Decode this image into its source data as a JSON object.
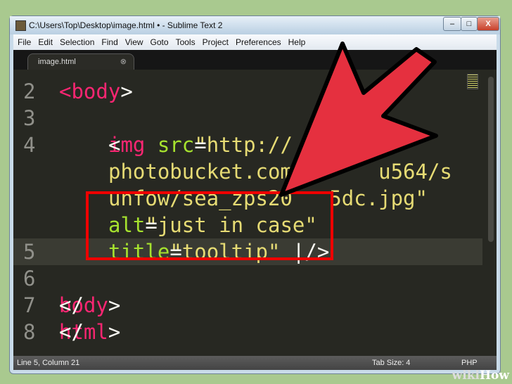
{
  "window": {
    "title": "C:\\Users\\Top\\Desktop\\image.html • - Sublime Text 2",
    "minimize": "–",
    "maximize": "□",
    "close": "X"
  },
  "menu": [
    "File",
    "Edit",
    "Selection",
    "Find",
    "View",
    "Goto",
    "Tools",
    "Project",
    "Preferences",
    "Help"
  ],
  "tab": {
    "label": "image.html",
    "close": "⊗"
  },
  "code": [
    {
      "num": "2",
      "parts": [
        [
          "tag",
          "<"
        ],
        [
          "tag",
          "body"
        ],
        [
          "tx",
          ">"
        ]
      ]
    },
    {
      "num": "3",
      "parts": []
    },
    {
      "num": "4",
      "parts": [
        [
          "tx",
          "<"
        ],
        [
          "tag",
          "img "
        ],
        [
          "attr",
          "src"
        ],
        [
          "tx",
          "="
        ],
        [
          "str",
          "\"http://"
        ]
      ]
    },
    {
      "num": "",
      "parts": [
        [
          "str",
          "photobucket.com/"
        ],
        [
          "str",
          "      "
        ],
        [
          "str",
          "u564/s"
        ]
      ]
    },
    {
      "num": "",
      "parts": [
        [
          "str",
          "unfow/sea_zps20"
        ],
        [
          "str",
          "   "
        ],
        [
          "str",
          "5dc.jpg\""
        ]
      ]
    },
    {
      "num": "",
      "parts": [
        [
          "attr",
          "alt"
        ],
        [
          "tx",
          "="
        ],
        [
          "str",
          "\"just in case\""
        ]
      ]
    },
    {
      "num": "5",
      "parts": [
        [
          "attr",
          "title"
        ],
        [
          "tx",
          "="
        ],
        [
          "str",
          "\"tooltip\""
        ],
        [
          "tx",
          " |/>"
        ]
      ]
    },
    {
      "num": "6",
      "parts": []
    },
    {
      "num": "7",
      "parts": [
        [
          "tx",
          "</"
        ],
        [
          "tag",
          "body"
        ],
        [
          "tx",
          ">"
        ]
      ]
    },
    {
      "num": "8",
      "parts": [
        [
          "tx",
          "</"
        ],
        [
          "tag",
          "html"
        ],
        [
          "tx",
          ">"
        ]
      ]
    }
  ],
  "status": {
    "position": "Line 5, Column 21",
    "tab_size": "Tab Size: 4",
    "syntax": "PHP"
  },
  "watermark": "wikiHow",
  "colors": {
    "arrow": "#e5303f",
    "highlight_box": "#ee0000"
  }
}
